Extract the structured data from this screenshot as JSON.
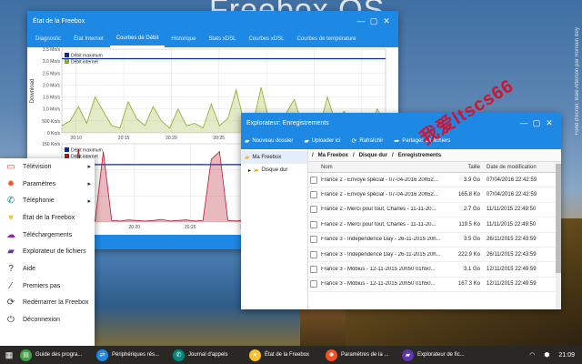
{
  "wallpaper": {
    "title": "Freebox OS",
    "credit": "Fond d'écran: Baie Afterson par Romain Bey"
  },
  "watermark": "我爱ltscs66",
  "stats_window": {
    "title": "État de la Freebox",
    "tabs": [
      "Diagnostic",
      "État Internet",
      "Courbes de Débit",
      "Historique",
      "Stats xDSL",
      "Courbes xDSL",
      "Courbes de température"
    ],
    "active_tab": 2
  },
  "chart_data": [
    {
      "type": "line",
      "title": "",
      "ylabel": "Download",
      "ylim": [
        0,
        3.5
      ],
      "ytick_labels": [
        "3.5 Mo/s",
        "3.0 Mo/s",
        "2.5 Mo/s",
        "2.0 Mo/s",
        "1.5 Mo/s",
        "1.0 Mo/s",
        "500 Ko/s",
        "0 Ko/s"
      ],
      "xtick_labels": [
        "20:10",
        "20:15",
        "20:20",
        "20:25",
        "20:30",
        "20:35",
        "20:40"
      ],
      "series": [
        {
          "name": "Débit maximum",
          "color": "#0d2b8a",
          "values": [
            3.1,
            3.1,
            3.1,
            3.1,
            3.1,
            3.1,
            3.1,
            3.1,
            3.1,
            3.1,
            3.1,
            3.1,
            3.1,
            3.1,
            3.1,
            3.1,
            3.1,
            3.1,
            3.1,
            3.1,
            3.1,
            3.1,
            3.1,
            3.1,
            3.1,
            3.1,
            3.1,
            3.1,
            3.1,
            3.1,
            3.1,
            3.1,
            3.1,
            3.1,
            3.1,
            3.1,
            3.1,
            3.1,
            3.1,
            3.1
          ]
        },
        {
          "name": "Débit internet",
          "color": "#8caa1e",
          "values": [
            0.3,
            0.5,
            1.1,
            0.4,
            1.5,
            0.9,
            0.3,
            0.2,
            1.3,
            0.6,
            0.3,
            1.1,
            0.5,
            0.2,
            1.0,
            0.3,
            0.4,
            0.2,
            1.2,
            0.3,
            0.6,
            1.8,
            0.4,
            0.3,
            1.9,
            0.5,
            0.2,
            0.8,
            1.4,
            0.3,
            0.7,
            0.2,
            1.5,
            0.4,
            0.9,
            0.3,
            0.6,
            0.2,
            1.0,
            0.4
          ]
        }
      ]
    },
    {
      "type": "area",
      "title": "",
      "ylabel": "",
      "ylim": [
        0,
        150
      ],
      "ytick_labels": [
        "150 Ko/s",
        "100 Ko/s",
        "50 Ko/s",
        "0 Ko/s"
      ],
      "xtick_labels": [
        "20:15",
        "20:20",
        "20:25",
        "20:30",
        "20:35",
        "20:40"
      ],
      "series": [
        {
          "name": "Débit maximum",
          "color": "#0d2b8a",
          "values": [
            110,
            110,
            110,
            110,
            110,
            110,
            110,
            110,
            110,
            110,
            110,
            110,
            110,
            110,
            110,
            110,
            110,
            110,
            110,
            110,
            110,
            110,
            110,
            110,
            110,
            110,
            110,
            110,
            110,
            110,
            110,
            110,
            110,
            110,
            110,
            110,
            110,
            110,
            110,
            110
          ]
        },
        {
          "name": "Débit internet",
          "color": "#b3192c",
          "values": [
            2,
            3,
            140,
            4,
            2,
            135,
            3,
            2,
            4,
            3,
            2,
            3,
            5,
            2,
            3,
            4,
            2,
            3,
            120,
            135,
            3,
            2,
            4,
            3,
            2,
            3,
            100,
            2,
            3,
            4,
            2,
            3,
            2,
            3,
            4,
            2,
            3,
            2,
            3,
            2
          ]
        }
      ]
    }
  ],
  "explorer": {
    "title": "Explorateur: Enregistrements",
    "toolbar": [
      "Nouveau dossier",
      "Uploader ici",
      "Rafraîchir",
      "Partages de fichiers"
    ],
    "tree": [
      "Ma Freebox",
      "Disque dur"
    ],
    "breadcrumb": [
      "Ma Freebox",
      "Disque dur",
      "Enregistrements"
    ],
    "columns": {
      "name": "Nom",
      "size": "Taille",
      "date": "Date de modification"
    },
    "rows": [
      {
        "name": "France 2 - Envoyé spécial - 07-04-2016 20h52...",
        "size": "3.9 Go",
        "date": "07/04/2016 22:42:59"
      },
      {
        "name": "France 2 - Envoyé spécial - 07-04-2016 20h52...",
        "size": "165.8 Ko",
        "date": "07/04/2016 22:42:59"
      },
      {
        "name": "France 2 - Merci pour tout, Charles - 11-11-20...",
        "size": "2.7 Go",
        "date": "11/11/2015 22:49:50"
      },
      {
        "name": "France 2 - Merci pour tout, Charles - 11-11-20...",
        "size": "119.5 Ko",
        "date": "11/11/2015 22:49:50"
      },
      {
        "name": "France 3 - Independence Day - 26-11-2015 20h...",
        "size": "3.5 Go",
        "date": "26/11/2015 22:43:59"
      },
      {
        "name": "France 3 - Independence Day - 26-11-2015 20h...",
        "size": "222.9 Ko",
        "date": "26/11/2015 22:43:59"
      },
      {
        "name": "France 3 - Möbius - 12-11-2015 20h50 01h50...",
        "size": "3.1 Go",
        "date": "12/11/2015 22:49:59"
      },
      {
        "name": "France 3 - Möbius - 12-11-2015 20h50 01h50...",
        "size": "167.3 Ko",
        "date": "12/11/2015 22:49:59"
      }
    ]
  },
  "menu": {
    "items": [
      {
        "label": "Télévision",
        "icon": "tv-icon",
        "glyph": "▭",
        "color": "#e53935",
        "submenu": true
      },
      {
        "label": "Paramètres",
        "icon": "gear-icon",
        "glyph": "✹",
        "color": "#f4511e",
        "submenu": true
      },
      {
        "label": "Téléphonie",
        "icon": "phone-icon",
        "glyph": "✆",
        "color": "#00897b",
        "submenu": true
      },
      {
        "label": "État de la Freebox",
        "icon": "heart-pulse-icon",
        "glyph": "♥",
        "color": "#fbc02d",
        "submenu": false
      },
      {
        "label": "Téléchargements",
        "icon": "cloud-download-icon",
        "glyph": "☁",
        "color": "#8e24aa",
        "submenu": false
      },
      {
        "label": "Explorateur de fichiers",
        "icon": "folder-icon",
        "glyph": "▰",
        "color": "#5e35b1",
        "submenu": false
      },
      {
        "label": "Aide",
        "icon": "help-icon",
        "glyph": "?",
        "color": "#333333",
        "submenu": false
      },
      {
        "label": "Premiers pas",
        "icon": "wand-icon",
        "glyph": "⁄",
        "color": "#333333",
        "submenu": false
      },
      {
        "label": "Redémarrer la Freebox",
        "icon": "restart-icon",
        "glyph": "⟳",
        "color": "#333333",
        "submenu": false
      },
      {
        "label": "Déconnexion",
        "icon": "logout-icon",
        "glyph": "⏻",
        "color": "#333333",
        "submenu": false
      }
    ]
  },
  "taskbar": {
    "items": [
      {
        "label": "Guide des progra...",
        "color": "#43a047"
      },
      {
        "label": "Périphériques rés...",
        "color": "#1e88e5"
      },
      {
        "label": "Journal d'appels",
        "color": "#00897b"
      },
      {
        "label": "État de la Freebox",
        "color": "#fbc02d"
      },
      {
        "label": "Paramètres de la ...",
        "color": "#f4511e"
      },
      {
        "label": "Explorateur de fic...",
        "color": "#5e35b1"
      }
    ],
    "clock": "21:09"
  }
}
